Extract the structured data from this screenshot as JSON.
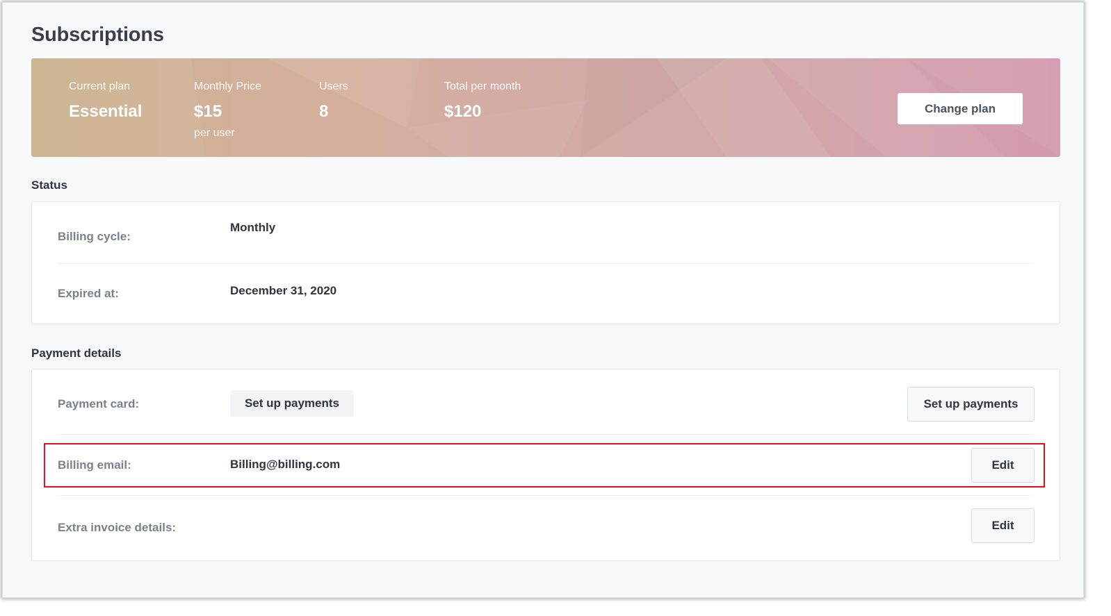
{
  "page": {
    "title": "Subscriptions"
  },
  "plan": {
    "current_plan_label": "Current plan",
    "current_plan_value": "Essential",
    "monthly_price_label": "Monthly Price",
    "monthly_price_value": "$15",
    "monthly_price_sub": "per user",
    "users_label": "Users",
    "users_value": "8",
    "total_label": "Total per month",
    "total_value": "$120",
    "change_plan_label": "Change plan"
  },
  "status": {
    "section_title": "Status",
    "billing_cycle_label": "Billing cycle:",
    "billing_cycle_value": "Monthly",
    "expired_label": "Expired at:",
    "expired_value": "December 31, 2020"
  },
  "payment": {
    "section_title": "Payment details",
    "card_label": "Payment card:",
    "card_setup_chip": "Set up payments",
    "card_setup_button": "Set up payments",
    "email_label": "Billing email:",
    "email_value": "Billing@billing.com",
    "email_edit": "Edit",
    "extra_label": "Extra invoice details:",
    "extra_edit": "Edit"
  },
  "colors": {
    "highlight": "#e0101e",
    "banner_start": "#cbb28d",
    "banner_end": "#d499b1"
  }
}
